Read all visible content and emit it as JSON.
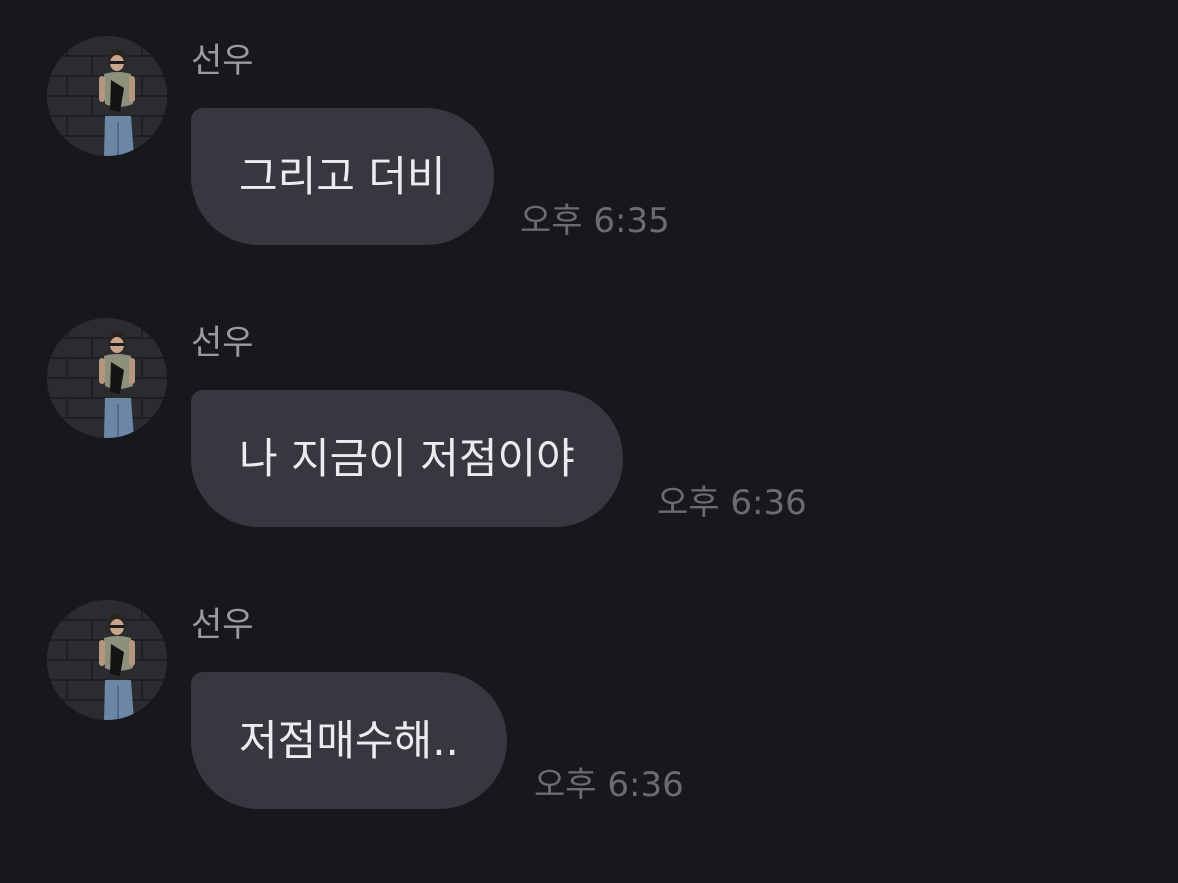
{
  "messages": [
    {
      "sender": "선우",
      "text": "그리고 더비",
      "time": "오후 6:35"
    },
    {
      "sender": "선우",
      "text": "나 지금이 저점이야",
      "time": "오후 6:36"
    },
    {
      "sender": "선우",
      "text": "저점매수해..",
      "time": "오후 6:36"
    }
  ],
  "colors": {
    "background": "#17181c",
    "bubble": "#36373f",
    "bubble_text": "#ececef",
    "sender": "#9a9ba0",
    "time": "#6b6c72"
  }
}
